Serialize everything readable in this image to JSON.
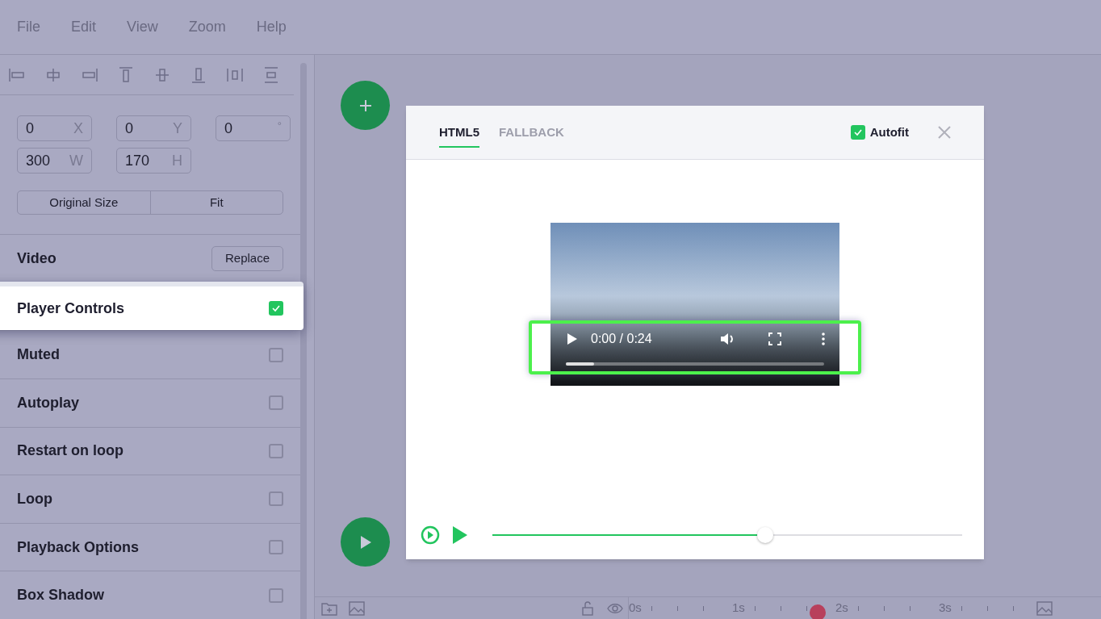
{
  "menu": [
    "File",
    "Edit",
    "View",
    "Zoom",
    "Help"
  ],
  "fields": [
    {
      "value": "0",
      "unit": "X"
    },
    {
      "value": "0",
      "unit": "Y"
    },
    {
      "value": "0",
      "unit": "°"
    },
    {
      "value": "300",
      "unit": "W"
    },
    {
      "value": "170",
      "unit": "H"
    }
  ],
  "size_buttons": [
    "Original Size",
    "Fit"
  ],
  "video_section": {
    "title": "Video",
    "button": "Replace"
  },
  "options": [
    {
      "label": "Player Controls",
      "checked": true,
      "highlighted": true
    },
    {
      "label": "Muted",
      "checked": false,
      "highlighted": false
    },
    {
      "label": "Autoplay",
      "checked": false,
      "highlighted": false
    },
    {
      "label": "Restart on loop",
      "checked": false,
      "highlighted": false
    },
    {
      "label": "Loop",
      "checked": false,
      "highlighted": false
    },
    {
      "label": "Playback Options",
      "checked": false,
      "highlighted": false
    },
    {
      "label": "Box Shadow",
      "checked": false,
      "highlighted": false
    }
  ],
  "preview": {
    "tabs": [
      {
        "label": "HTML5",
        "selected": true
      },
      {
        "label": "FALLBACK",
        "selected": false
      }
    ],
    "autofit": {
      "label": "Autofit",
      "checked": true
    },
    "video": {
      "time": "0:00 / 0:24",
      "level": 0.11,
      "controls_highlighted": true
    },
    "scrubber": {
      "level": 0.58
    }
  },
  "timeline": {
    "labels": [
      "0s",
      "1s",
      "2s",
      "3s"
    ],
    "playhead": {
      "level": 0.5
    }
  }
}
